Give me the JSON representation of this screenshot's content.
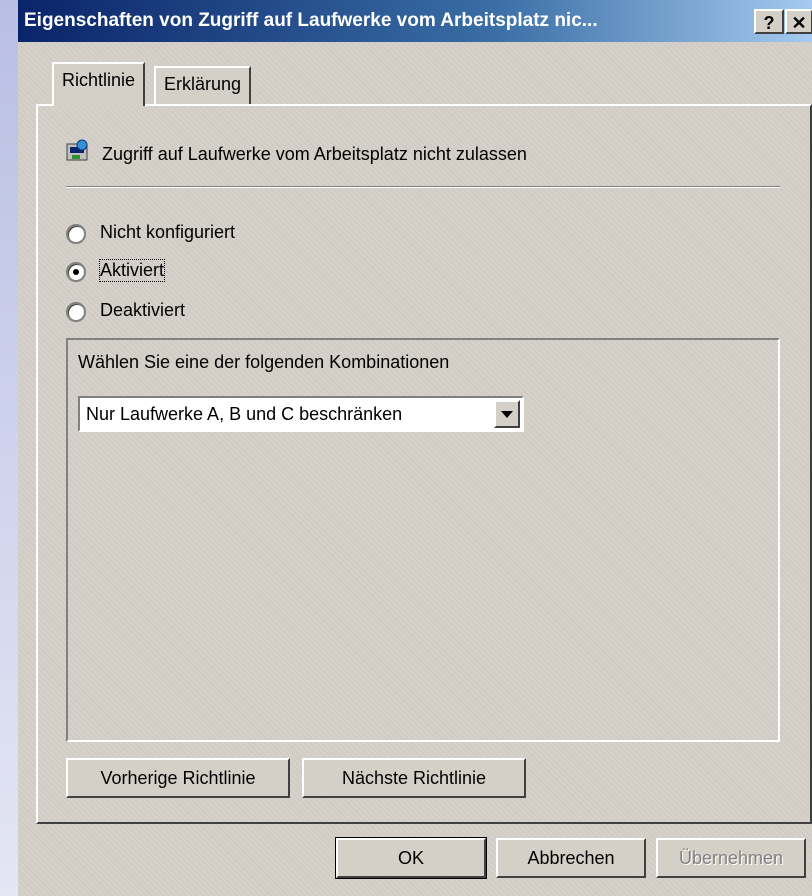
{
  "window": {
    "title": "Eigenschaften von Zugriff auf Laufwerke vom Arbeitsplatz nic...",
    "help_glyph": "?",
    "close_glyph": "✕"
  },
  "tabs": [
    {
      "label": "Richtlinie",
      "active": true
    },
    {
      "label": "Erklärung",
      "active": false
    }
  ],
  "policy": {
    "icon": "policy-settings-icon",
    "title": "Zugriff auf Laufwerke vom Arbeitsplatz nicht zulassen"
  },
  "options": [
    {
      "label": "Nicht konfiguriert",
      "selected": false
    },
    {
      "label": "Aktiviert",
      "selected": true
    },
    {
      "label": "Deaktiviert",
      "selected": false
    }
  ],
  "group": {
    "label": "Wählen Sie eine der folgenden Kombinationen",
    "combo_value": "Nur Laufwerke A, B und C beschränken"
  },
  "nav_buttons": {
    "previous": "Vorherige Richtlinie",
    "next": "Nächste Richtlinie"
  },
  "dialog_buttons": {
    "ok": "OK",
    "cancel": "Abbrechen",
    "apply": "Übernehmen"
  },
  "colors": {
    "title_bar_start": "#0a246a",
    "title_bar_end": "#a6caf0",
    "dialog_face": "#d4d0c8"
  }
}
